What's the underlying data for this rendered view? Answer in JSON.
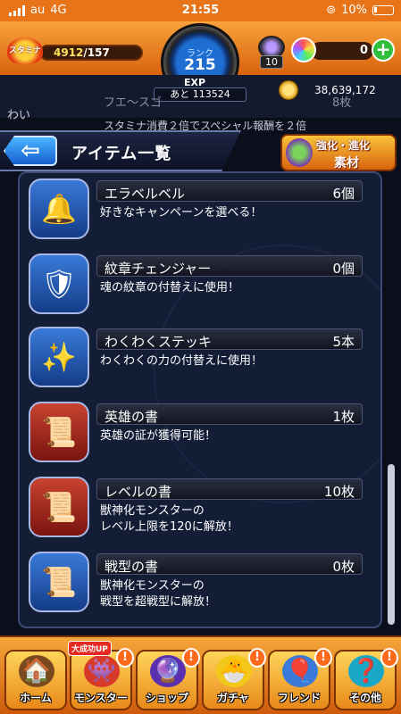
{
  "status_bar": {
    "carrier": "au",
    "network": "4G",
    "time": "21:55",
    "battery": "10%"
  },
  "hud": {
    "stamina_label": "スタミナ",
    "stamina_current": "4912",
    "stamina_max": "/157",
    "rank_label": "ランク",
    "rank_value": "215",
    "ball_count": "10",
    "orb_count": "0",
    "exp_label": "EXP",
    "exp_remaining": "あと 113524",
    "coins": "38,639,172"
  },
  "background_row": {
    "left_text": "わい",
    "item_name": "フエ～スゴ",
    "item_count": "8枚",
    "desc": "スタミナ消費２倍でスペシャル報酬を２倍"
  },
  "header": {
    "title": "アイテム一覧",
    "evo_line1": "強化・進化",
    "evo_line2": "素材"
  },
  "items": [
    {
      "name": "エラベルベル",
      "count": "6個",
      "desc": "好きなキャンペーンを選べる！",
      "icon": "bell-icon",
      "glyph": "🔔"
    },
    {
      "name": "紋章チェンジャー",
      "count": "0個",
      "desc": "魂の紋章の付替えに使用！",
      "icon": "emblem-changer-icon",
      "glyph": "🛡"
    },
    {
      "name": "わくわくステッキ",
      "count": "5本",
      "desc": "わくわくの力の付替えに使用！",
      "icon": "magic-stick-icon",
      "glyph": "✨"
    },
    {
      "name": "英雄の書",
      "count": "1枚",
      "desc": "英雄の証が獲得可能！",
      "icon": "hero-book-icon",
      "glyph": "📜"
    },
    {
      "name": "レベルの書",
      "count": "10枚",
      "desc": "獣神化モンスターの\nレベル上限を120に解放！",
      "icon": "level-book-icon",
      "glyph": "📜"
    },
    {
      "name": "戦型の書",
      "count": "0枚",
      "desc": "獣神化モンスターの\n戦型を超戦型に解放！",
      "icon": "battle-type-book-icon",
      "glyph": "📜"
    }
  ],
  "nav": [
    {
      "label": "ホーム",
      "icon": "home-icon",
      "glyph": "🏠"
    },
    {
      "label": "モンスター",
      "icon": "monster-icon",
      "glyph": "👾",
      "badge": "大成功UP"
    },
    {
      "label": "ショップ",
      "icon": "shop-orb-icon",
      "glyph": "🔮"
    },
    {
      "label": "ガチャ",
      "icon": "gacha-icon",
      "glyph": "🐣"
    },
    {
      "label": "フレンド",
      "icon": "friend-icon",
      "glyph": "🎈"
    },
    {
      "label": "その他",
      "icon": "other-icon",
      "glyph": "❓"
    }
  ],
  "colors": {
    "accent_orange": "#e8741a",
    "panel": "#161e38",
    "back_blue": "#1560d0"
  }
}
